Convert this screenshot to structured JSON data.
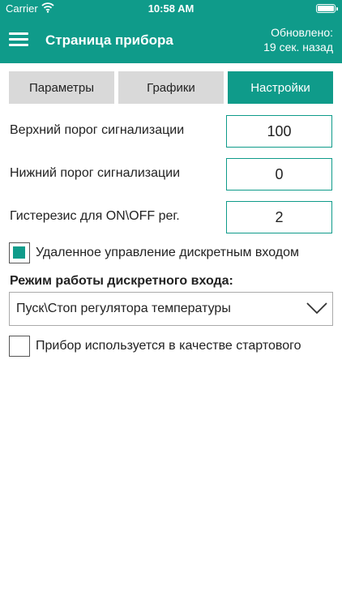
{
  "status_bar": {
    "carrier": "Carrier",
    "time": "10:58 AM"
  },
  "header": {
    "title": "Страница прибора",
    "updated_line1": "Обновлено:",
    "updated_line2": "19 сек. назад"
  },
  "tabs": [
    {
      "label": "Параметры",
      "active": false
    },
    {
      "label": "Графики",
      "active": false
    },
    {
      "label": "Настройки",
      "active": true
    }
  ],
  "fields": [
    {
      "label": "Верхний порог сигнализации",
      "value": "100"
    },
    {
      "label": "Нижний порог сигнализации",
      "value": "0"
    },
    {
      "label": "Гистерезис для ON\\OFF рег.",
      "value": "2"
    }
  ],
  "remote_control": {
    "label": "Удаленное управление дискретным входом",
    "checked": true
  },
  "discrete_mode": {
    "title": "Режим работы дискретного входа:",
    "selected": "Пуск\\Стоп регулятора температуры"
  },
  "starter_device": {
    "label": "Прибор используется в качестве стартового",
    "checked": false
  },
  "colors": {
    "accent": "#0f9b8a",
    "tab_inactive": "#d9d9d9"
  },
  "icons": {
    "menu": "hamburger-menu-icon",
    "wifi": "wifi-icon",
    "battery": "battery-icon",
    "dropdown": "chevron-down-icon"
  }
}
